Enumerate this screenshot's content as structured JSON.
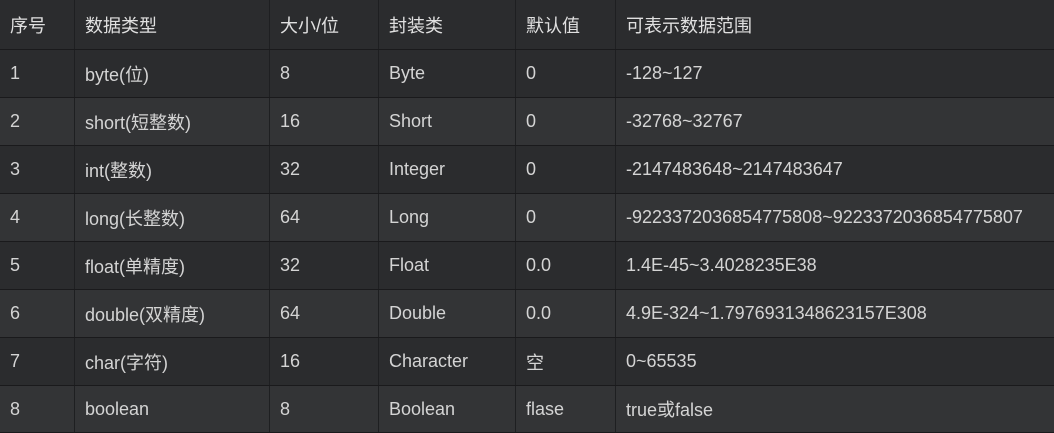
{
  "table": {
    "headers": [
      "序号",
      "数据类型",
      "大小/位",
      "封装类",
      "默认值",
      "可表示数据范围"
    ],
    "rows": [
      [
        "1",
        "byte(位)",
        "8",
        "Byte",
        "0",
        "-128~127"
      ],
      [
        "2",
        "short(短整数)",
        "16",
        "Short",
        "0",
        "-32768~32767"
      ],
      [
        "3",
        "int(整数)",
        "32",
        "Integer",
        "0",
        "-2147483648~2147483647"
      ],
      [
        "4",
        "long(长整数)",
        "64",
        "Long",
        "0",
        "-9223372036854775808~9223372036854775807"
      ],
      [
        "5",
        "float(单精度)",
        "32",
        "Float",
        "0.0",
        "1.4E-45~3.4028235E38"
      ],
      [
        "6",
        "double(双精度)",
        "64",
        "Double",
        "0.0",
        "4.9E-324~1.7976931348623157E308"
      ],
      [
        "7",
        "char(字符)",
        "16",
        "Character",
        "空",
        "0~65535"
      ],
      [
        "8",
        "boolean",
        "8",
        "Boolean",
        "flase",
        "true或false"
      ]
    ]
  }
}
